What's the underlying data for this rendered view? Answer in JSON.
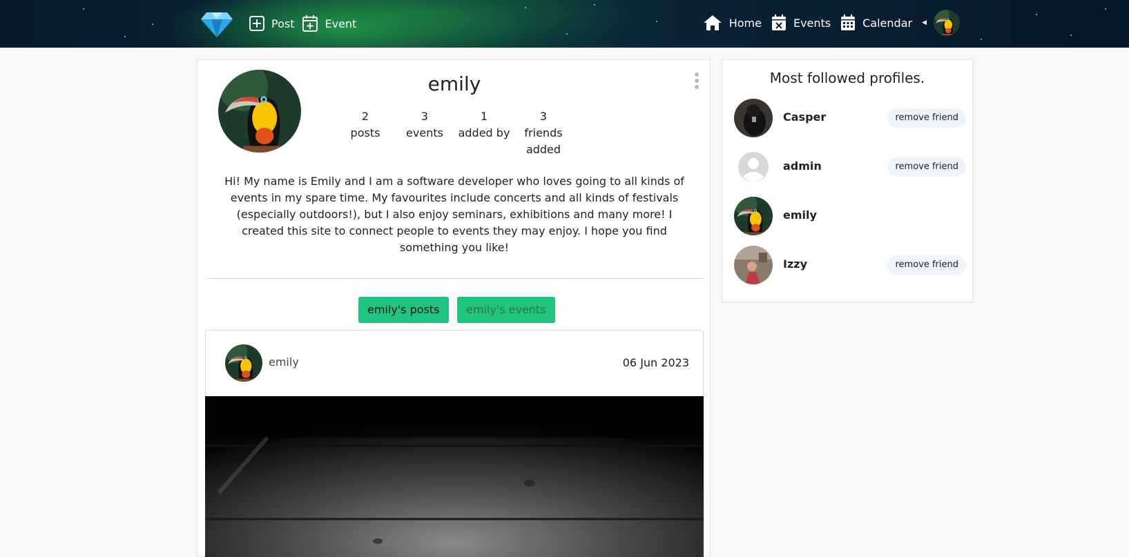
{
  "nav": {
    "logo_icon": "diamond-icon",
    "post_label": "Post",
    "event_label": "Event",
    "home_label": "Home",
    "events_label": "Events",
    "calendar_label": "Calendar"
  },
  "profile": {
    "username": "emily",
    "stats": [
      {
        "value": "2",
        "label": "posts"
      },
      {
        "value": "3",
        "label": "events"
      },
      {
        "value": "1",
        "label": "added by"
      },
      {
        "value": "3",
        "label": "friends added"
      }
    ],
    "bio": "Hi! My name is Emily and I am a software developer who loves going to all kinds of events in my spare time. My favourites include concerts and all kinds of festivals (especially outdoors!), but I also enjoy seminars, exhibitions and many more! I created this site to connect people to events they may enjoy. I hope you find something you like!",
    "tabs": {
      "posts": "emily's posts",
      "events": "emily's events"
    }
  },
  "post": {
    "author": "emily",
    "date": "06 Jun 2023"
  },
  "sidebar": {
    "title": "Most followed profiles.",
    "friends": [
      {
        "name": "Casper",
        "action": "remove friend"
      },
      {
        "name": "admin",
        "action": "remove friend"
      },
      {
        "name": "emily",
        "action": ""
      },
      {
        "name": "Izzy",
        "action": "remove friend"
      }
    ]
  },
  "colors": {
    "accent": "#1fc47e",
    "nav_bg": "#0a2236",
    "remove_btn_bg": "#eef4fb"
  }
}
